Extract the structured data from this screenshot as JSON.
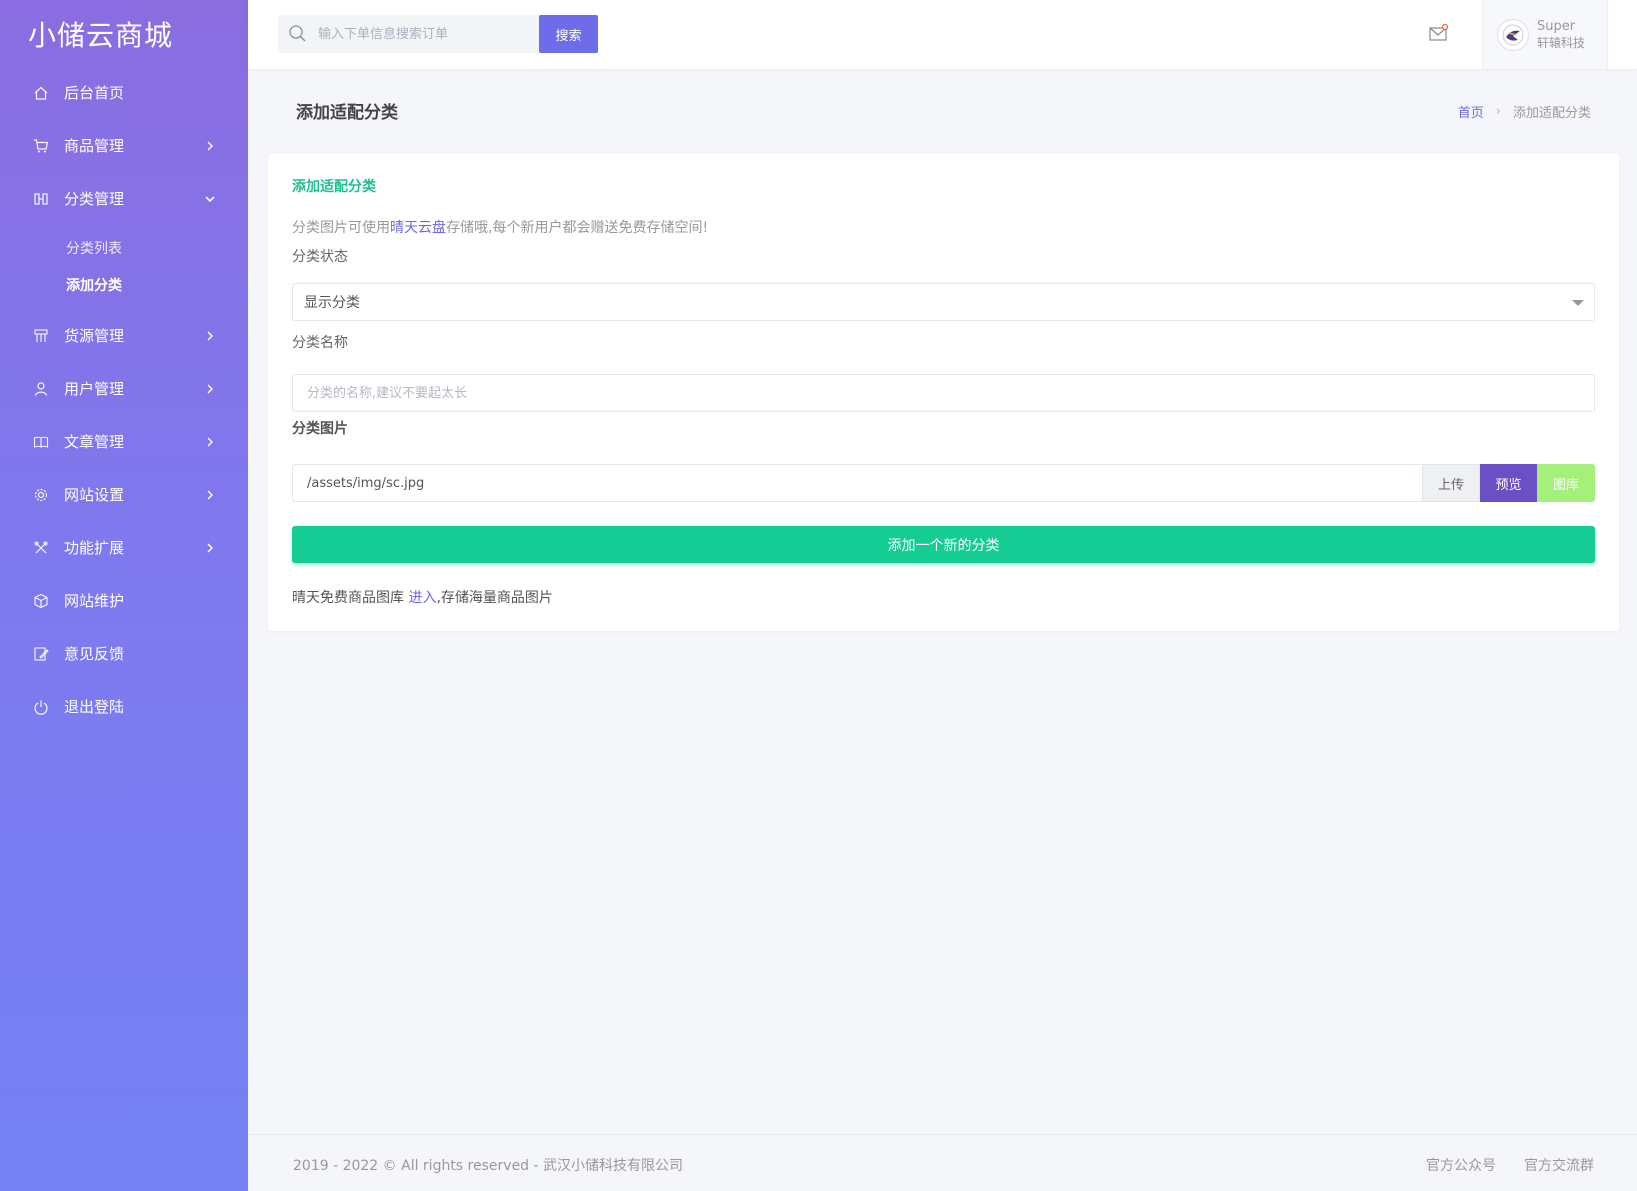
{
  "sidebar": {
    "brand": "小储云商城",
    "items": [
      {
        "label": "后台首页",
        "icon": "home-icon",
        "has_arrow": false
      },
      {
        "label": "商品管理",
        "icon": "cart-icon",
        "has_arrow": true
      },
      {
        "label": "分类管理",
        "icon": "columns-icon",
        "has_arrow": true,
        "expanded": true,
        "sub": [
          {
            "label": "分类列表"
          },
          {
            "label": "添加分类",
            "active": true
          }
        ]
      },
      {
        "label": "货源管理",
        "icon": "grid-icon",
        "has_arrow": true
      },
      {
        "label": "用户管理",
        "icon": "user-icon",
        "has_arrow": true
      },
      {
        "label": "文章管理",
        "icon": "book-icon",
        "has_arrow": true
      },
      {
        "label": "网站设置",
        "icon": "gear-icon",
        "has_arrow": true
      },
      {
        "label": "功能扩展",
        "icon": "tools-icon",
        "has_arrow": true
      },
      {
        "label": "网站维护",
        "icon": "cube-icon",
        "has_arrow": false
      },
      {
        "label": "意见反馈",
        "icon": "feedback-icon",
        "has_arrow": false
      },
      {
        "label": "退出登陆",
        "icon": "power-icon",
        "has_arrow": false
      }
    ]
  },
  "topbar": {
    "search_placeholder": "输入下单信息搜索订单",
    "search_button": "搜索",
    "user_name": "Super",
    "user_company": "轩辕科技"
  },
  "page": {
    "title": "添加适配分类",
    "breadcrumb_home": "首页",
    "breadcrumb_current": "添加适配分类"
  },
  "form": {
    "card_title": "添加适配分类",
    "notice_prefix": "分类图片可使用",
    "notice_link": "晴天云盘",
    "notice_suffix": "存储哦,每个新用户都会赠送免费存储空间!",
    "status_label": "分类状态",
    "status_value": "显示分类",
    "name_label": "分类名称",
    "name_placeholder": "分类的名称,建议不要起太长",
    "image_label": "分类图片",
    "image_value": "/assets/img/sc.jpg",
    "upload_button": "上传",
    "preview_button": "预览",
    "gallery_button": "图库",
    "submit_button": "添加一个新的分类",
    "tip_prefix": "晴天免费商品图库 ",
    "tip_link": "进入",
    "tip_suffix": ",存储海量商品图片"
  },
  "footer": {
    "copyright": "2019 - 2022 © All rights reserved - 武汉小储科技有限公司",
    "link_1": "官方公众号",
    "link_2": "官方交流群"
  },
  "colors": {
    "sidebar_top": "#8a6de0",
    "sidebar_bottom": "#7582f5",
    "accent": "#6f6cea",
    "success": "#15cd94",
    "preview": "#6b4fc4",
    "gallery": "#a5ef7b"
  }
}
